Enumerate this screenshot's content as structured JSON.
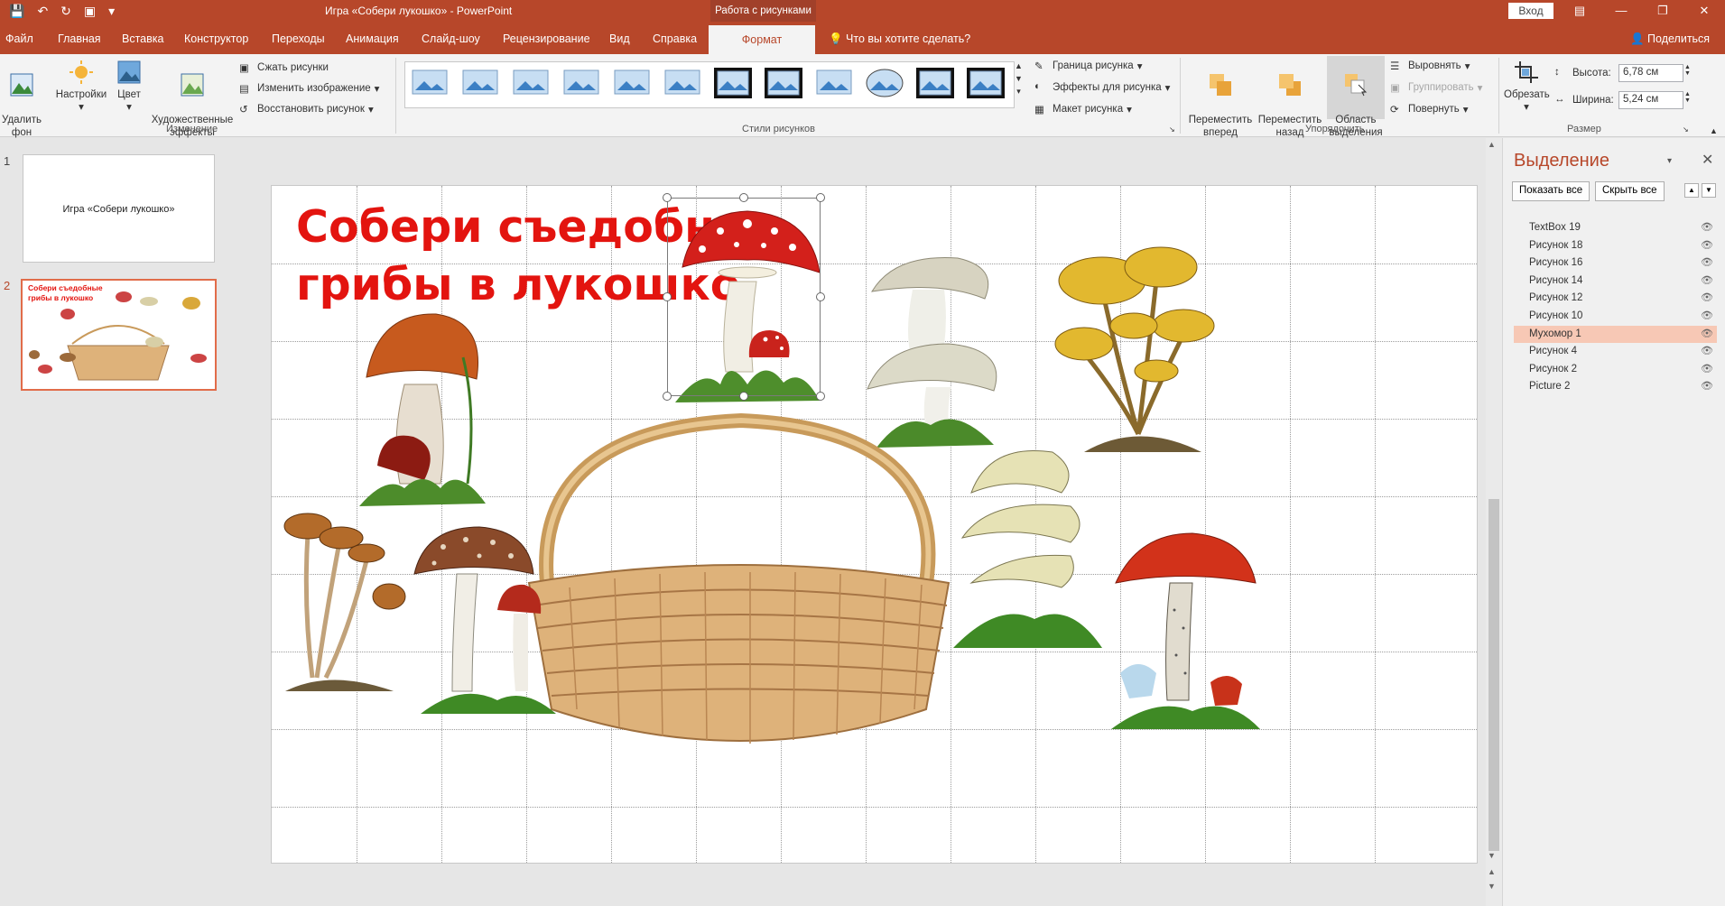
{
  "titlebar": {
    "doc_title": "Игра «Собери лукошко»  -  PowerPoint",
    "context_tab": "Работа с рисунками",
    "login": "Вход"
  },
  "tabs": [
    "Файл",
    "Главная",
    "Вставка",
    "Конструктор",
    "Переходы",
    "Анимация",
    "Слайд-шоу",
    "Рецензирование",
    "Вид",
    "Справка"
  ],
  "active_tab": "Формат",
  "help_text": "Что вы хотите сделать?",
  "share_label": "Поделиться",
  "ribbon": {
    "remove_bg": "Удалить\nфон",
    "corrections": "Настройки",
    "color": "Цвет",
    "artistic": "Художественные\nэффекты",
    "compress": "Сжать рисунки",
    "change": "Изменить изображение",
    "reset": "Восстановить рисунок",
    "group_adjust": "Изменение",
    "group_styles": "Стили рисунков",
    "border": "Граница рисунка",
    "effects": "Эффекты для рисунка",
    "layout": "Макет рисунка",
    "bring_forward": "Переместить\nвперед",
    "send_backward": "Переместить\nназад",
    "selection_pane": "Область\nвыделения",
    "align": "Выровнять",
    "group": "Группировать",
    "rotate": "Повернуть",
    "group_arrange": "Упорядочить",
    "crop": "Обрезать",
    "height_label": "Высота:",
    "height_value": "6,78 см",
    "width_label": "Ширина:",
    "width_value": "5,24 см",
    "group_size": "Размер"
  },
  "slides": [
    {
      "number": "1",
      "title": "Игра «Собери лукошко»"
    },
    {
      "number": "2",
      "title": "Собери съедобные грибы в лукошко"
    }
  ],
  "slide_title": "Собери съедобные\nгрибы в лукошко",
  "selection_pane": {
    "title": "Выделение",
    "show_all": "Показать все",
    "hide_all": "Скрыть все",
    "items": [
      "TextBox 19",
      "Рисунок 18",
      "Рисунок 16",
      "Рисунок 14",
      "Рисунок 12",
      "Рисунок 10",
      "Мухомор 1",
      "Рисунок 4",
      "Рисунок 2",
      "Picture 2"
    ],
    "selected": "Мухомор 1"
  },
  "colors": {
    "accent": "#b7472a",
    "title_red": "#e3140f",
    "selected_row": "#f7c8b5"
  }
}
